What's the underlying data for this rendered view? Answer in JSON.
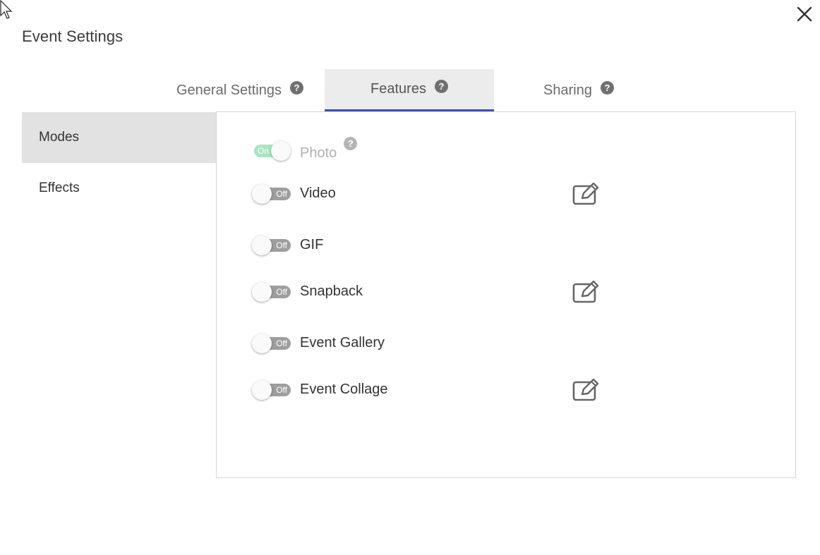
{
  "dialog": {
    "title": "Event Settings"
  },
  "tabs": [
    {
      "label": "General Settings",
      "active": false
    },
    {
      "label": "Features",
      "active": true
    },
    {
      "label": "Sharing",
      "active": false
    }
  ],
  "tab_help_symbol": "?",
  "sidebar": {
    "items": [
      {
        "label": "Modes",
        "active": true
      },
      {
        "label": "Effects",
        "active": false
      }
    ]
  },
  "features": [
    {
      "label": "Photo",
      "state": "On",
      "disabled": true,
      "help": "?"
    },
    {
      "label": "Video",
      "state": "Off",
      "editable": true
    },
    {
      "label": "GIF",
      "state": "Off",
      "editable": false
    },
    {
      "label": "Snapback",
      "state": "Off",
      "editable": true
    },
    {
      "label": "Event Gallery",
      "state": "Off",
      "editable": false
    },
    {
      "label": "Event Collage",
      "state": "Off",
      "editable": true
    }
  ],
  "colors": {
    "accent": "#3f51b5",
    "toggle_off": "#9e9e9e",
    "toggle_on": "#a8e6bf",
    "active_tab_bg": "#ececec",
    "active_sidebar_bg": "#e2e2e2"
  },
  "icons": {
    "close": "close-icon",
    "edit": "edit-icon",
    "help": "help-icon",
    "cursor": "mouse-cursor-icon"
  }
}
